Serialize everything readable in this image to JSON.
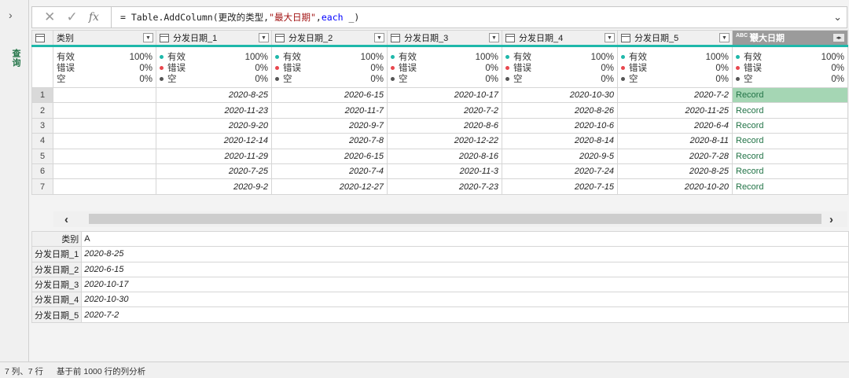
{
  "sidebar": {
    "expand_icon": "chevron-right-icon",
    "label": "查询"
  },
  "formula": {
    "cancel_glyph": "✕",
    "confirm_glyph": "✓",
    "fx_glyph": "fx",
    "prefix": "= Table.AddColumn(更改的类型,",
    "string": "\"最大日期\"",
    "comma": ",",
    "keyword": "each",
    "suffix": " _)",
    "dropdown_glyph": "⌄"
  },
  "grid": {
    "columns": [
      {
        "name": "类别",
        "type_icon": "text-type-icon"
      },
      {
        "name": "分发日期_1",
        "type_icon": "date-type-icon"
      },
      {
        "name": "分发日期_2",
        "type_icon": "date-type-icon"
      },
      {
        "name": "分发日期_3",
        "type_icon": "date-type-icon"
      },
      {
        "name": "分发日期_4",
        "type_icon": "date-type-icon"
      },
      {
        "name": "分发日期_5",
        "type_icon": "date-type-icon"
      },
      {
        "name": "最大日期",
        "type_icon": "any-type-icon",
        "type_glyph": "ABC 123"
      }
    ],
    "profile": {
      "valid_label": "有效",
      "error_label": "错误",
      "empty_label": "空",
      "valid_pct": "100%",
      "error_pct": "0%",
      "empty_pct": "0%"
    },
    "rows": [
      {
        "n": "1",
        "a": "",
        "d1": "2020-8-25",
        "d2": "2020-6-15",
        "d3": "2020-10-17",
        "d4": "2020-10-30",
        "d5": "2020-7-2",
        "max": "Record"
      },
      {
        "n": "2",
        "a": "",
        "d1": "2020-11-23",
        "d2": "2020-11-7",
        "d3": "2020-7-2",
        "d4": "2020-8-26",
        "d5": "2020-11-25",
        "max": "Record"
      },
      {
        "n": "3",
        "a": "",
        "d1": "2020-9-20",
        "d2": "2020-9-7",
        "d3": "2020-8-6",
        "d4": "2020-10-6",
        "d5": "2020-6-4",
        "max": "Record"
      },
      {
        "n": "4",
        "a": "",
        "d1": "2020-12-14",
        "d2": "2020-7-8",
        "d3": "2020-12-22",
        "d4": "2020-8-14",
        "d5": "2020-8-11",
        "max": "Record"
      },
      {
        "n": "5",
        "a": "",
        "d1": "2020-11-29",
        "d2": "2020-6-15",
        "d3": "2020-8-16",
        "d4": "2020-9-5",
        "d5": "2020-7-28",
        "max": "Record"
      },
      {
        "n": "6",
        "a": "",
        "d1": "2020-7-25",
        "d2": "2020-7-4",
        "d3": "2020-11-3",
        "d4": "2020-7-24",
        "d5": "2020-8-25",
        "max": "Record"
      },
      {
        "n": "7",
        "a": "",
        "d1": "2020-9-2",
        "d2": "2020-12-27",
        "d3": "2020-7-23",
        "d4": "2020-7-15",
        "d5": "2020-10-20",
        "max": "Record"
      }
    ]
  },
  "scrollbar": {
    "left_glyph": "‹",
    "right_glyph": "›"
  },
  "detail": [
    {
      "key": "类别",
      "value": "A"
    },
    {
      "key": "分发日期_1",
      "value": "2020-8-25"
    },
    {
      "key": "分发日期_2",
      "value": "2020-6-15"
    },
    {
      "key": "分发日期_3",
      "value": "2020-10-17"
    },
    {
      "key": "分发日期_4",
      "value": "2020-10-30"
    },
    {
      "key": "分发日期_5",
      "value": "2020-7-2"
    }
  ],
  "status": {
    "counts": "7 列、7 行",
    "profiling": "基于前 1000 行的列分析"
  },
  "colors": {
    "accent": "#217346",
    "profile_bar": "#1fb8aa",
    "valid": "#1fb8aa",
    "error": "#e8474e",
    "empty": "#555555"
  }
}
